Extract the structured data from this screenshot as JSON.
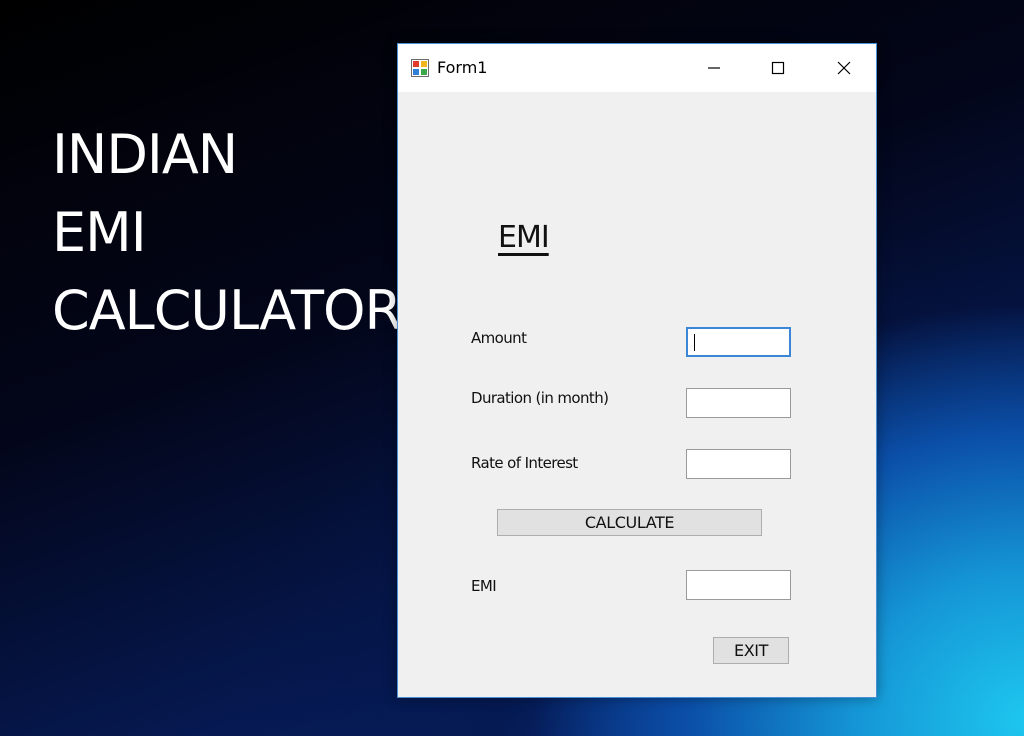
{
  "desktop": {
    "headline": [
      "INDIAN",
      "EMI",
      "CALCULATOR"
    ]
  },
  "window": {
    "title": "Form1",
    "icon": "winforms-app-icon",
    "controls": {
      "minimize_icon": "minimize-icon",
      "maximize_icon": "maximize-icon",
      "close_icon": "close-icon"
    }
  },
  "form": {
    "heading": "EMI",
    "amount_label": "Amount",
    "amount_value": "",
    "duration_label": "Duration (in month)",
    "duration_value": "",
    "rate_label": "Rate of Interest",
    "rate_value": "",
    "calculate_label": "CALCULATE",
    "emi_label": "EMI",
    "emi_value": "",
    "exit_label": "EXIT"
  },
  "colors": {
    "window_border": "#4a90d6",
    "form_background": "#f0f0f0",
    "focus_border": "#3b86d6",
    "button_face": "#e1e1e1"
  }
}
